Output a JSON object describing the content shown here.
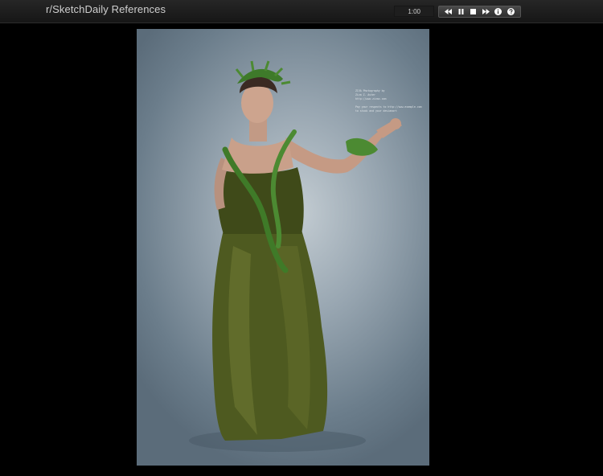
{
  "header": {
    "title": "r/SketchDaily References",
    "timer": "1:00"
  },
  "controls": {
    "icons": [
      "rewind-icon",
      "pause-icon",
      "stop-icon",
      "fast-forward-icon",
      "info-icon",
      "help-icon"
    ]
  },
  "photo": {
    "watermark_lines": [
      "ZIVA Photography by",
      "Ziva Z. Aster",
      "http://www.zivaz.com",
      "",
      "Pay your respects to http://www.example.com",
      "to stock and your devianart"
    ]
  },
  "colors": {
    "background": "#000000",
    "topbar": "#1c1c1c",
    "title_text": "#cfcfcf",
    "dress_green": "#4f5a1f"
  }
}
